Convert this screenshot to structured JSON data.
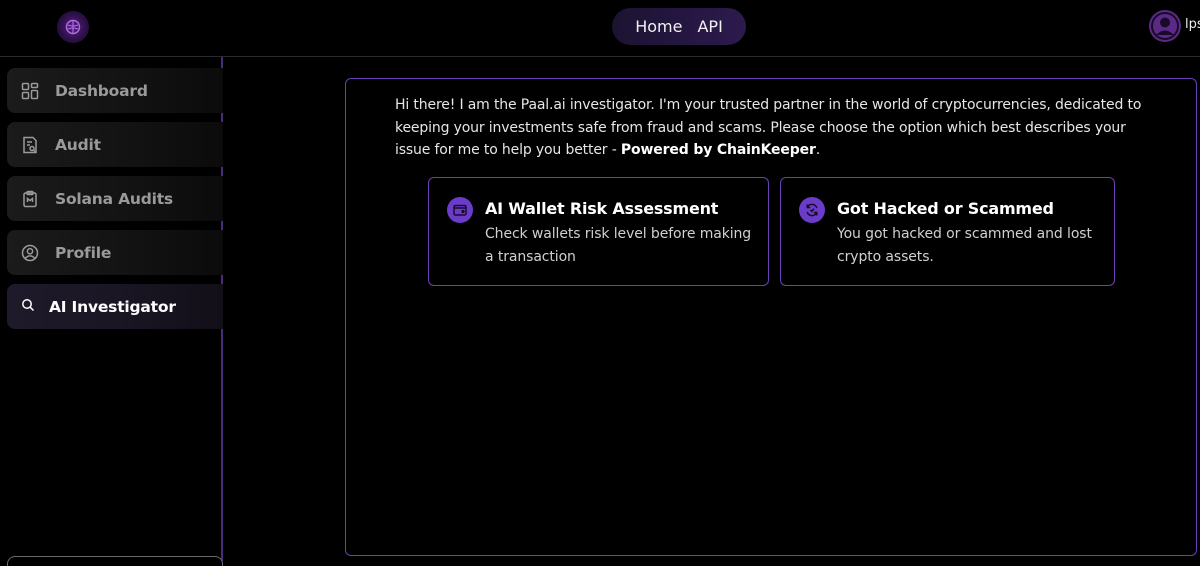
{
  "header": {
    "nav": [
      {
        "label": "Home"
      },
      {
        "label": "API"
      }
    ],
    "user": {
      "name": "lps"
    },
    "logo_icon": "brain-icon",
    "avatar_icon": "user-avatar-icon"
  },
  "sidebar": {
    "items": [
      {
        "label": "Dashboard",
        "icon": "dashboard-grid-icon"
      },
      {
        "label": "Audit",
        "icon": "audit-document-icon"
      },
      {
        "label": "Solana Audits",
        "icon": "clipboard-icon"
      },
      {
        "label": "Profile",
        "icon": "profile-user-icon"
      },
      {
        "label": "AI Investigator",
        "icon": "search-icon",
        "active": true
      }
    ]
  },
  "main": {
    "intro_text": "Hi there! I am the Paal.ai investigator. I'm your trusted partner in the world of cryptocurrencies, dedicated to keeping your investments safe from fraud and scams. Please choose the option which best describes your issue for me to help you better - ",
    "intro_bold": "Powered by ChainKeeper",
    "intro_end": ".",
    "options": [
      {
        "title": "AI Wallet Risk Assessment",
        "description": "Check wallets risk level before making a transaction",
        "icon": "wallet-icon"
      },
      {
        "title": "Got Hacked or Scammed",
        "description": "You got hacked or scammed and lost crypto assets.",
        "icon": "refresh-cycle-icon"
      }
    ]
  },
  "colors": {
    "accent": "#6b3fb5",
    "icon_bg": "#6a3cc9",
    "background": "#000000"
  }
}
